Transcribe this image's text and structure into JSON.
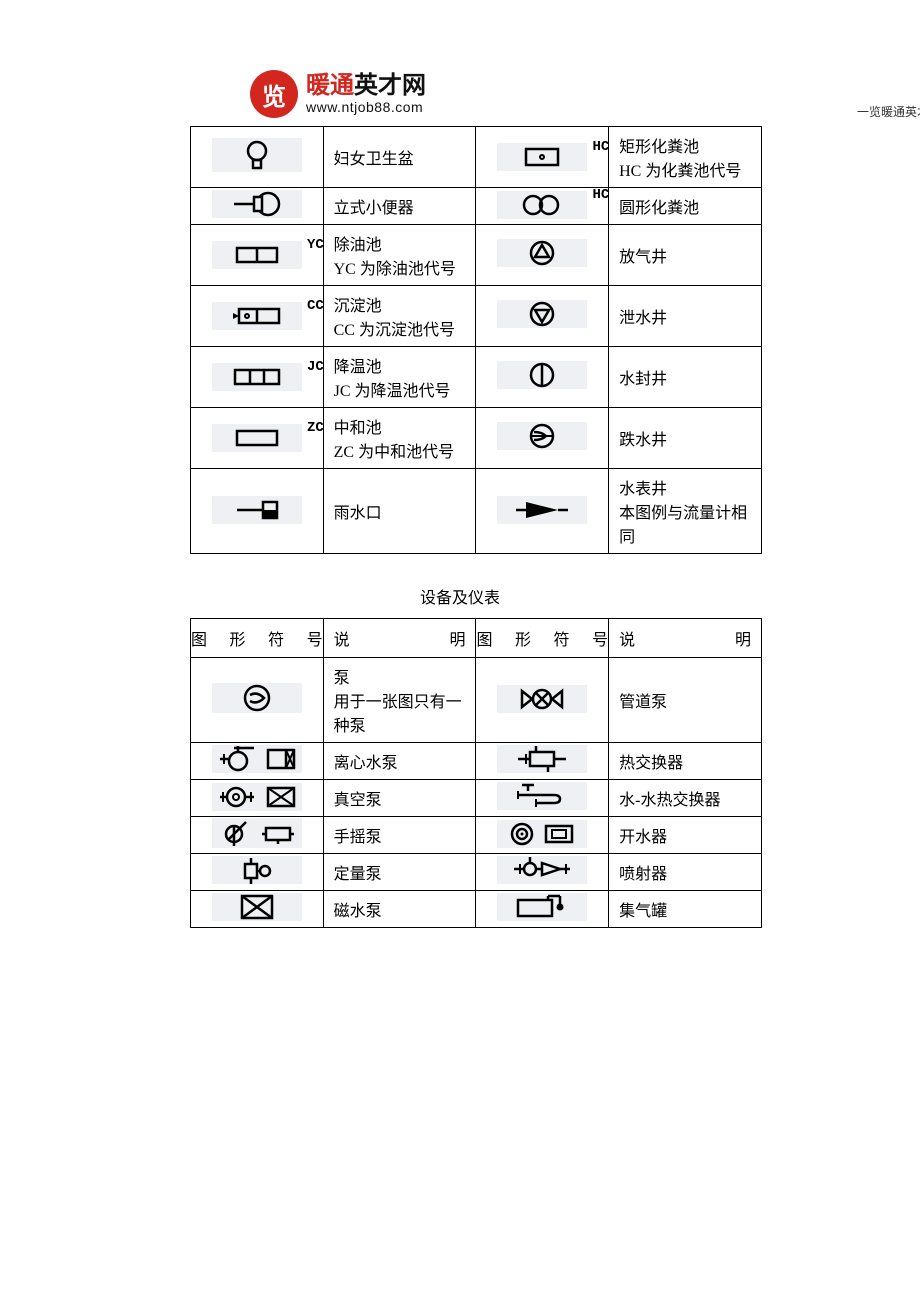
{
  "header": {
    "logo_char": "览",
    "brand_red": "暖通",
    "brand_black": "英才网",
    "url": "www.ntjob88.com",
    "note": "一览暖通英才网收集，仅共参考"
  },
  "table1": {
    "rows": [
      {
        "code1": "",
        "desc1": "妇女卫生盆",
        "code2": "HC",
        "desc2": "矩形化粪池\nHC 为化粪池代号"
      },
      {
        "code1": "",
        "desc1": "立式小便器",
        "code2": "HC",
        "desc2": "圆形化粪池"
      },
      {
        "code1": "YC",
        "desc1": "除油池\nYC 为除油池代号",
        "code2": "",
        "desc2": "放气井"
      },
      {
        "code1": "CC",
        "desc1": "沉淀池\nCC 为沉淀池代号",
        "code2": "",
        "desc2": "泄水井"
      },
      {
        "code1": "JC",
        "desc1": "降温池\nJC 为降温池代号",
        "code2": "",
        "desc2": "水封井"
      },
      {
        "code1": "ZC",
        "desc1": "中和池\nZC 为中和池代号",
        "code2": "",
        "desc2": "跌水井"
      },
      {
        "code1": "",
        "desc1": "雨水口",
        "code2": "",
        "desc2": "水表井\n本图例与流量计相同"
      }
    ]
  },
  "section2_title": "设备及仪表",
  "table2": {
    "headers": {
      "h1": "图 形 符 号",
      "h2a": "说",
      "h2b": "明",
      "h3": "图 形 符 号",
      "h4a": "说",
      "h4b": "明"
    },
    "rows": [
      {
        "desc1": "泵\n用于一张图只有一种泵",
        "desc2": "管道泵"
      },
      {
        "desc1": "离心水泵",
        "desc2": "热交换器"
      },
      {
        "desc1": "真空泵",
        "desc2": "水-水热交换器"
      },
      {
        "desc1": "手摇泵",
        "desc2": "开水器"
      },
      {
        "desc1": "定量泵",
        "desc2": "喷射器"
      },
      {
        "desc1": "磁水泵",
        "desc2": "集气罐"
      }
    ]
  }
}
